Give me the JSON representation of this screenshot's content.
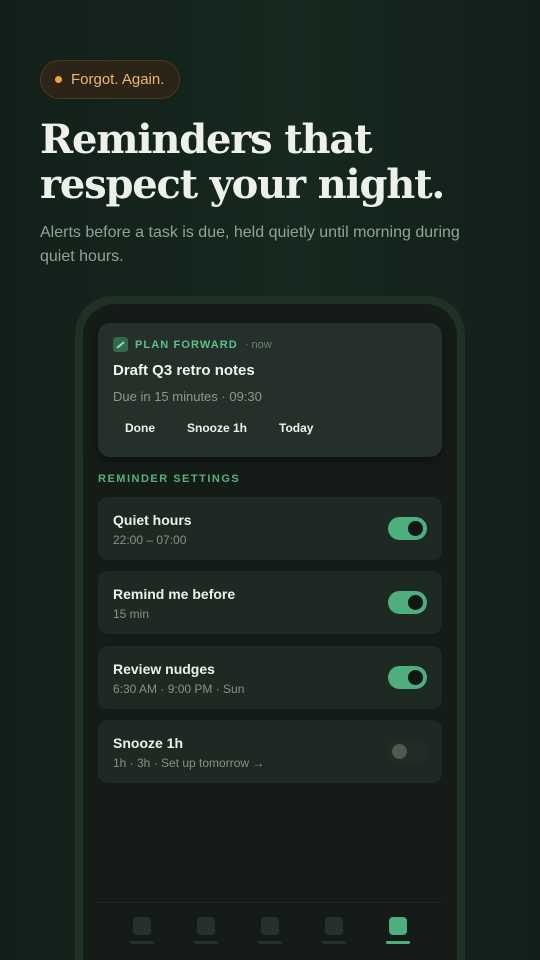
{
  "badge": {
    "label": "Forgot. Again."
  },
  "headline": {
    "line1": "Reminders that",
    "line2": "respect your night."
  },
  "subtitle": "Alerts before a task is due, held quietly until morning during quiet hours.",
  "notification": {
    "app_name": "PLAN FORWARD",
    "time": "· now",
    "title": "Draft Q3 retro notes",
    "subtitle": "Due in 15 minutes · 09:30",
    "actions": [
      "Done",
      "Snooze 1h",
      "Today"
    ]
  },
  "settings": {
    "section_label": "REMINDER SETTINGS",
    "items": [
      {
        "title": "Quiet hours",
        "subtitle": "22:00 – 07:00",
        "enabled": true
      },
      {
        "title": "Remind me before",
        "subtitle": "15 min",
        "enabled": true
      },
      {
        "title": "Review nudges",
        "subtitle": "6:30 AM · 9:00 PM · Sun",
        "enabled": true
      },
      {
        "title": "Snooze 1h",
        "subtitle": "1h · 3h · Set up tomorrow →",
        "enabled": false
      }
    ]
  },
  "tabbar": {
    "tab_count": 5,
    "active_index": 4
  },
  "colors": {
    "accent": "#4fae7d",
    "badge_dot": "#f0a33a",
    "background": "#13221c"
  }
}
